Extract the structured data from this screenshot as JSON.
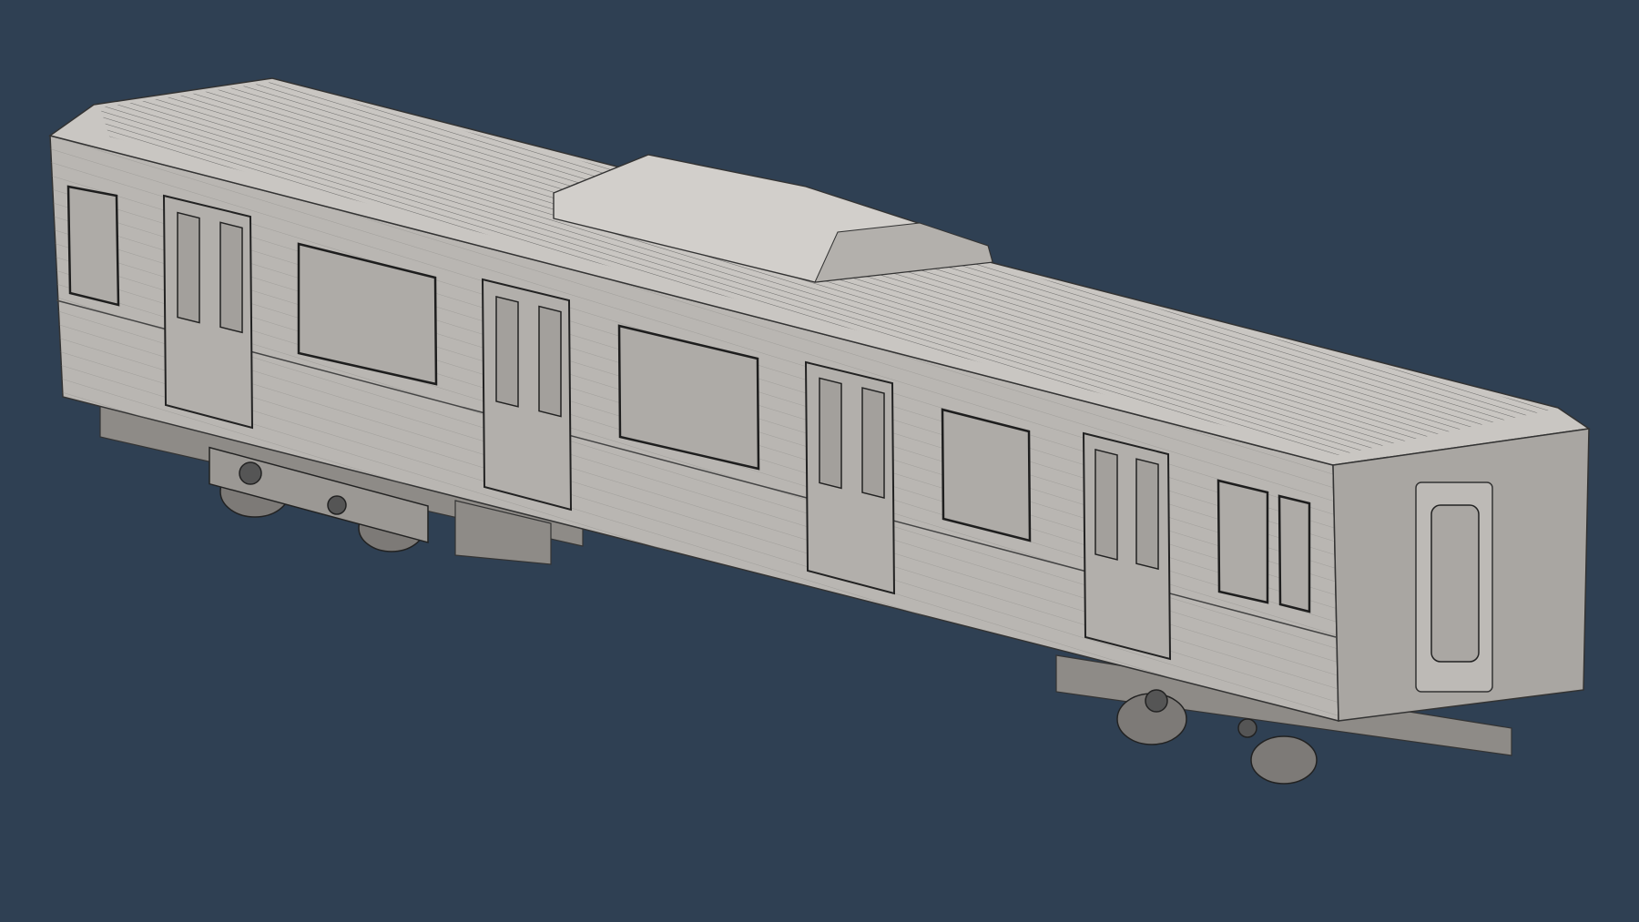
{
  "scene": {
    "subject": "train-car-3d-model",
    "colors": {
      "background": "#2f4053",
      "body": "#b9b6b2",
      "roof": "#c9c6c2",
      "end": "#a9a6a2",
      "line": "#3a3a3a",
      "undercarriage": "#8e8b87"
    }
  }
}
